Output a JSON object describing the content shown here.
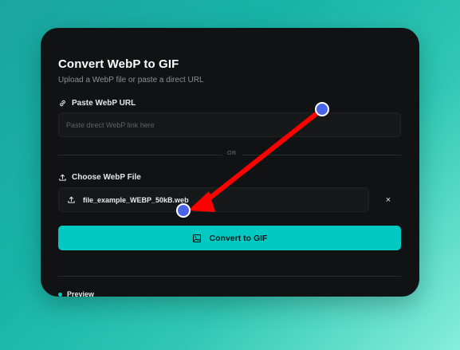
{
  "card": {
    "title": "Convert WebP to GIF",
    "subtitle": "Upload a WebP file or paste a direct URL"
  },
  "url_section": {
    "label": "Paste WebP URL",
    "icon": "link-icon",
    "value": "",
    "placeholder": "Paste direct WebP link here"
  },
  "separator": {
    "text": "OR"
  },
  "file_section": {
    "label": "Choose WebP File",
    "icon": "upload-icon",
    "file_name": "file_example_WEBP_50kB.web",
    "clear_label": "×"
  },
  "convert_button": {
    "label": "Convert to GIF",
    "icon": "image-icon"
  },
  "preview": {
    "label": "Preview"
  },
  "annotation": {
    "arrow_color": "#ff0000",
    "marker_color": "#4a64e8"
  },
  "colors": {
    "accent": "#03c9c3",
    "card_bg": "#111213"
  }
}
